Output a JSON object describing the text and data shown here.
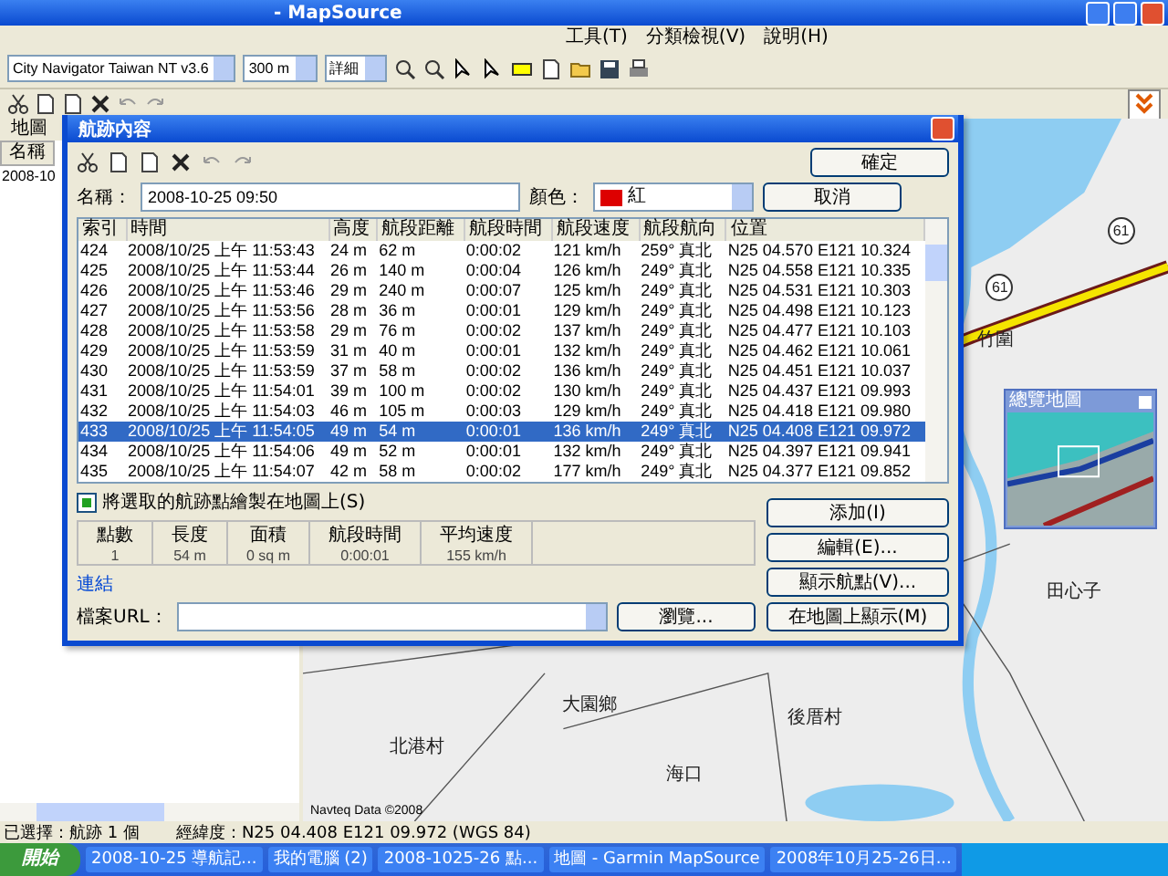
{
  "window": {
    "title": "- MapSource"
  },
  "menu": [
    "工具(T)",
    "分類檢視(V)",
    "說明(H)"
  ],
  "toolbar": {
    "map_product": "City Navigator Taiwan NT v3.6",
    "zoom": "300 m",
    "detail": "詳細"
  },
  "left_panel": {
    "tabs": [
      "地圖"
    ],
    "column": "名稱",
    "rows": [
      "2008-10"
    ]
  },
  "dialog": {
    "title": "航跡內容",
    "name_label": "名稱：",
    "name_value": "2008-10-25 09:50",
    "color_label": "顏色：",
    "color_value": "紅",
    "color": "#dd0000",
    "buttons_top": [
      "確定",
      "取消"
    ],
    "columns": [
      "索引",
      "時間",
      "高度",
      "航段距離",
      "航段時間",
      "航段速度",
      "航段航向",
      "位置"
    ],
    "rows": [
      {
        "cells": [
          "424",
          "2008/10/25 上午 11:53:43",
          "24 m",
          "62 m",
          "0:00:02",
          "121 km/h",
          "259° 真北",
          "N25 04.570 E121 10.324"
        ],
        "selected": false
      },
      {
        "cells": [
          "425",
          "2008/10/25 上午 11:53:44",
          "26 m",
          "140 m",
          "0:00:04",
          "126 km/h",
          "249° 真北",
          "N25 04.558 E121 10.335"
        ],
        "selected": false
      },
      {
        "cells": [
          "426",
          "2008/10/25 上午 11:53:46",
          "29 m",
          "240 m",
          "0:00:07",
          "125 km/h",
          "249° 真北",
          "N25 04.531 E121 10.303"
        ],
        "selected": false
      },
      {
        "cells": [
          "427",
          "2008/10/25 上午 11:53:56",
          "28 m",
          "36 m",
          "0:00:01",
          "129 km/h",
          "249° 真北",
          "N25 04.498 E121 10.123"
        ],
        "selected": false
      },
      {
        "cells": [
          "428",
          "2008/10/25 上午 11:53:58",
          "29 m",
          "76 m",
          "0:00:02",
          "137 km/h",
          "249° 真北",
          "N25 04.477 E121 10.103"
        ],
        "selected": false
      },
      {
        "cells": [
          "429",
          "2008/10/25 上午 11:53:59",
          "31 m",
          "40 m",
          "0:00:01",
          "132 km/h",
          "249° 真北",
          "N25 04.462 E121 10.061"
        ],
        "selected": false
      },
      {
        "cells": [
          "430",
          "2008/10/25 上午 11:53:59",
          "37 m",
          "58 m",
          "0:00:02",
          "136 km/h",
          "249° 真北",
          "N25 04.451 E121 10.037"
        ],
        "selected": false
      },
      {
        "cells": [
          "431",
          "2008/10/25 上午 11:54:01",
          "39 m",
          "100 m",
          "0:00:02",
          "130 km/h",
          "249° 真北",
          "N25 04.437 E121 09.993"
        ],
        "selected": false
      },
      {
        "cells": [
          "432",
          "2008/10/25 上午 11:54:03",
          "46 m",
          "105 m",
          "0:00:03",
          "129 km/h",
          "249° 真北",
          "N25 04.418 E121 09.980"
        ],
        "selected": false
      },
      {
        "cells": [
          "433",
          "2008/10/25 上午 11:54:05",
          "49 m",
          "54 m",
          "0:00:01",
          "136 km/h",
          "249° 真北",
          "N25 04.408 E121 09.972"
        ],
        "selected": true
      },
      {
        "cells": [
          "434",
          "2008/10/25 上午 11:54:06",
          "49 m",
          "52 m",
          "0:00:01",
          "132 km/h",
          "249° 真北",
          "N25 04.397 E121 09.941"
        ],
        "selected": false
      },
      {
        "cells": [
          "435",
          "2008/10/25 上午 11:54:07",
          "42 m",
          "58 m",
          "0:00:02",
          "177 km/h",
          "249° 真北",
          "N25 04.377 E121 09.852"
        ],
        "selected": false
      }
    ],
    "checkbox": {
      "label": "將選取的航跡點繪製在地圖上(S)",
      "checked": true
    },
    "stats": [
      {
        "label": "點數",
        "value": "1"
      },
      {
        "label": "長度",
        "value": "54 m"
      },
      {
        "label": "面積",
        "value": "0 sq m"
      },
      {
        "label": "航段時間",
        "value": "0:00:01"
      },
      {
        "label": "平均速度",
        "value": "155 km/h"
      }
    ],
    "link_group": "連結",
    "url_label": "檔案URL：",
    "browse": "瀏覽...",
    "buttons_side": [
      "添加(I)",
      "編輯(E)...",
      "顯示航點(V)...",
      "在地圖上顯示(M)"
    ]
  },
  "map": {
    "labels": [
      {
        "text": "61",
        "kind": "shield"
      },
      {
        "text": "61",
        "kind": "shield"
      },
      {
        "text": "大園鄉",
        "kind": "place"
      },
      {
        "text": "竹圍",
        "kind": "place"
      },
      {
        "text": "後厝村",
        "kind": "place"
      },
      {
        "text": "北港村",
        "kind": "place"
      },
      {
        "text": "海口",
        "kind": "place"
      },
      {
        "text": "田心子",
        "kind": "place"
      }
    ],
    "copyright": "Navteq Data ©2008",
    "overview_title": "總覽地圖"
  },
  "status_bar": [
    "已選擇：航跡 1 個",
    "經緯度：N25 04.408 E121 09.972 (WGS 84)"
  ],
  "taskbar": {
    "start": "開始",
    "tasks": [
      "2008-10-25 導航記...",
      "我的電腦 (2)",
      "2008-1025-26 點...",
      "地圖 - Garmin MapSource",
      "2008年10月25-26日..."
    ]
  }
}
